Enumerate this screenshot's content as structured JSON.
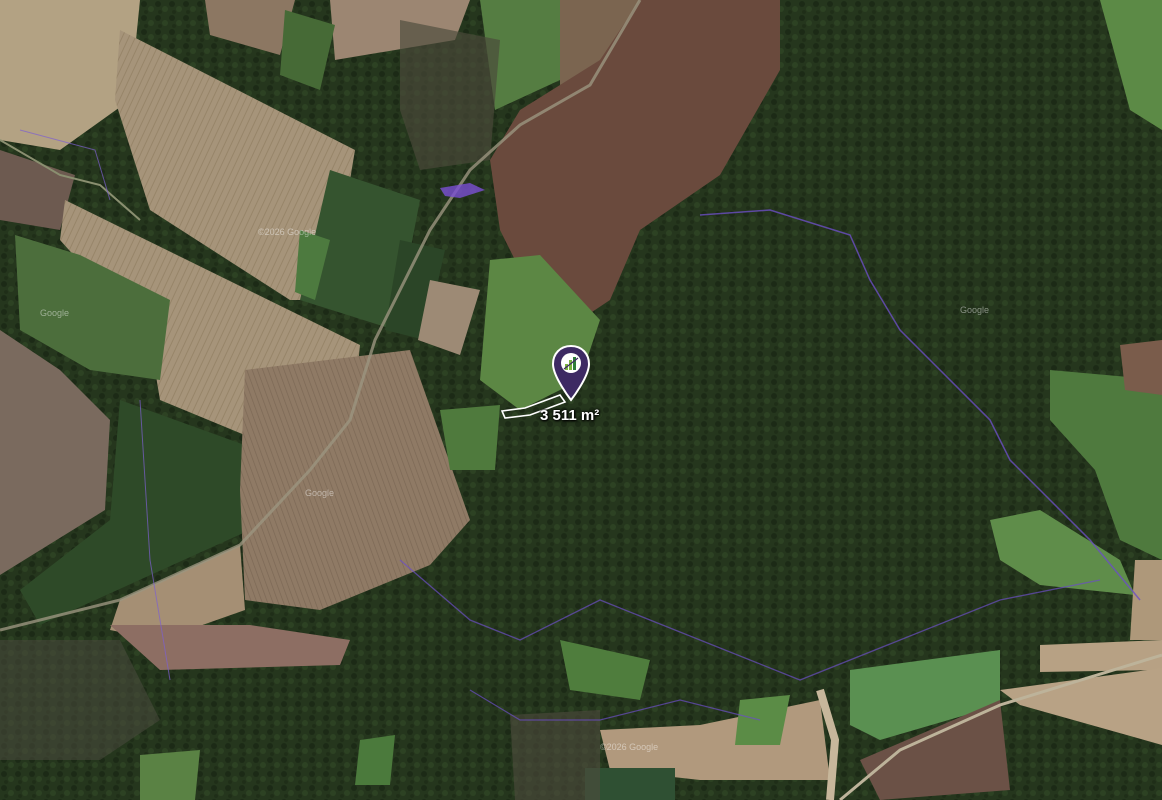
{
  "map": {
    "view": "satellite",
    "watermark": "©2026 Google",
    "small_labels": [
      "Google",
      "Google",
      "Google",
      "©2026 Google"
    ]
  },
  "parcel": {
    "marker_icon": "parcel-pin-icon",
    "marker_color": "#3d2a63",
    "area_label": "3 511 m²"
  },
  "colors": {
    "forest": "#23331c",
    "field_brown": "#6a4a3a",
    "field_tan": "#a89778",
    "meadow": "#5d8a4a",
    "boundary_line": "#6b4fc4"
  }
}
